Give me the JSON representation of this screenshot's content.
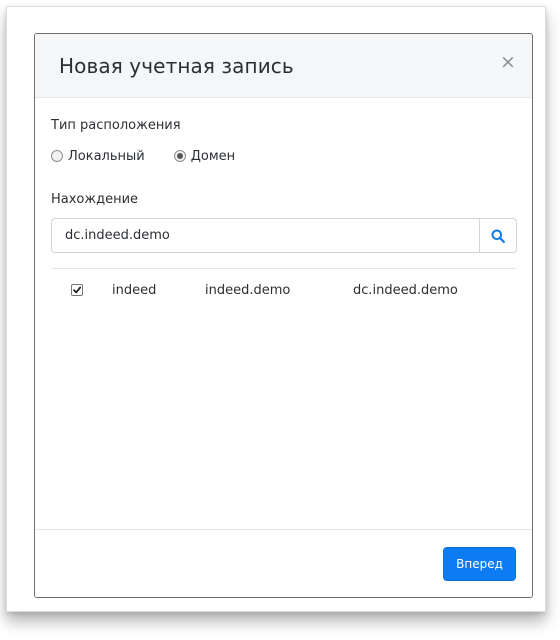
{
  "dialog": {
    "title": "Новая учетная запись",
    "close_symbol": "×"
  },
  "location_type": {
    "label": "Тип расположения",
    "options": [
      {
        "label": "Локальный",
        "checked": false
      },
      {
        "label": "Домен",
        "checked": true
      }
    ]
  },
  "finding": {
    "label": "Нахождение",
    "search_value": "dc.indeed.demo",
    "search_icon": "search-icon"
  },
  "results": [
    {
      "checked": true,
      "name": "indeed",
      "domain": "indeed.demo",
      "controller": "dc.indeed.demo"
    }
  ],
  "footer": {
    "next_label": "Вперед"
  },
  "colors": {
    "primary": "#0d7cf2",
    "header_bg": "#f5f6f8",
    "border": "#ced4da"
  }
}
